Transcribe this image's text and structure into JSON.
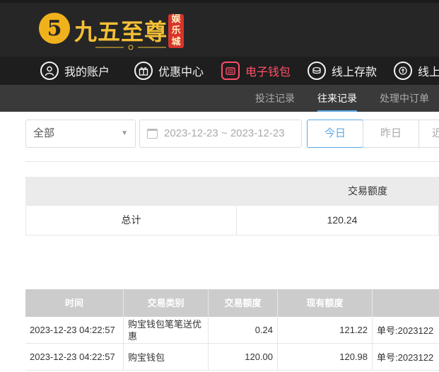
{
  "brand": {
    "logo_glyph": "5",
    "name": "九五至尊",
    "tag": "娱乐城"
  },
  "main_nav": [
    {
      "label": "我的账户",
      "icon": "user-icon",
      "active": false
    },
    {
      "label": "优惠中心",
      "icon": "gift-icon",
      "active": false
    },
    {
      "label": "电子钱包",
      "icon": "wallet-icon",
      "active": true
    },
    {
      "label": "线上存款",
      "icon": "deposit-icon",
      "active": false
    },
    {
      "label": "线上",
      "icon": "withdraw-icon",
      "active": false
    }
  ],
  "sub_nav": [
    {
      "label": "投注记录",
      "active": false
    },
    {
      "label": "往来记录",
      "active": true
    },
    {
      "label": "处理中订单",
      "active": false
    }
  ],
  "filters": {
    "type_select": "全部",
    "date_range": "2023-12-23 ~ 2023-12-23",
    "today": "今日",
    "yesterday": "昨日",
    "more": "近"
  },
  "summary": {
    "header": "交易额度",
    "label": "总计",
    "value": "120.24"
  },
  "records": {
    "columns": [
      "时间",
      "交易类别",
      "交易额度",
      "现有额度",
      ""
    ],
    "rows": [
      {
        "time": "2023-12-23 04:22:57",
        "type": "购宝钱包笔笔送优惠",
        "amount": "0.24",
        "balance": "121.22",
        "note": "单号:2023122"
      },
      {
        "time": "2023-12-23 04:22:57",
        "type": "购宝钱包",
        "amount": "120.00",
        "balance": "120.98",
        "note": "单号:2023122"
      }
    ]
  },
  "colors": {
    "header_bg": "#262626",
    "nav_bg": "#1e1e1e",
    "subnav_bg": "#3a3a3a",
    "brand_gold": "#f5c034",
    "active_nav": "#ff4f6a",
    "accent_blue": "#5aa8e6",
    "table_head_bg": "#cccccc"
  }
}
